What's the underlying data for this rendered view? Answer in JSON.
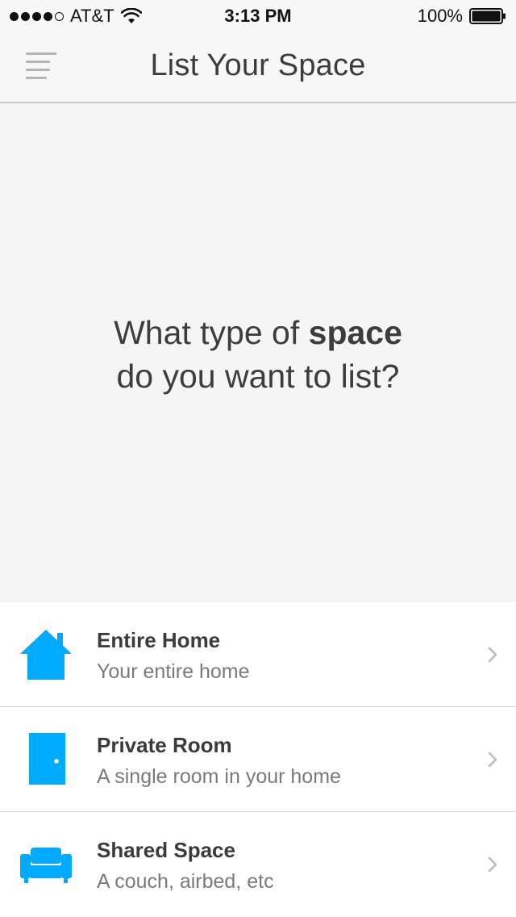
{
  "status_bar": {
    "carrier": "AT&T",
    "signal_bars_filled": 4,
    "signal_bars_total": 5,
    "time": "3:13 PM",
    "battery_percent": "100%"
  },
  "nav": {
    "title": "List Your Space",
    "menu_icon": "hamburger-menu-icon"
  },
  "hero": {
    "question_prefix": "What type of ",
    "question_bold": "space",
    "question_line2": "do you want to list?"
  },
  "options": [
    {
      "title": "Entire Home",
      "subtitle": "Your entire home",
      "icon": "house-icon"
    },
    {
      "title": "Private Room",
      "subtitle": "A single room in your home",
      "icon": "door-icon"
    },
    {
      "title": "Shared Space",
      "subtitle": "A couch, airbed, etc",
      "icon": "couch-icon"
    }
  ],
  "colors": {
    "accent": "#00aaff",
    "background": "#f7f7f7",
    "divider": "#d4d4d4",
    "chevron": "#bcbcbc"
  }
}
